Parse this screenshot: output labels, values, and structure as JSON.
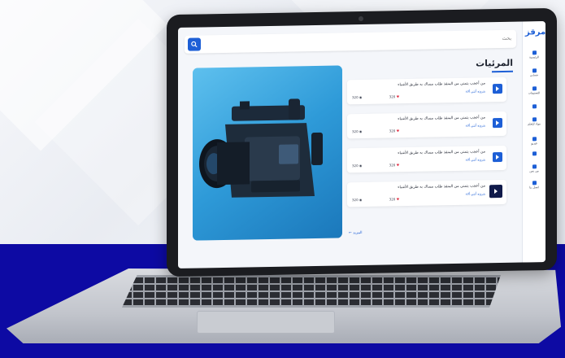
{
  "app": {
    "logo_text": "مرقز",
    "search": {
      "placeholder": "بحث"
    },
    "page_title": "المرئيات",
    "sidebar": {
      "items": [
        {
          "icon": "home-icon",
          "label": "الرئيسية"
        },
        {
          "icon": "user-icon",
          "label": "حسابي"
        },
        {
          "icon": "grid-icon",
          "label": "التصنيفات"
        },
        {
          "icon": "list-icon",
          "label": ""
        },
        {
          "icon": "book-icon",
          "label": "مواد للتعلم"
        },
        {
          "icon": "video-icon",
          "label": "فيديو"
        },
        {
          "icon": "doc-icon",
          "label": ""
        },
        {
          "icon": "edit-icon",
          "label": "من نحن"
        },
        {
          "icon": "mail-icon",
          "label": "اتصل بنا"
        }
      ]
    },
    "list": {
      "items": [
        {
          "title": "من أعجب يتمنى من المنقذ طلب مساك به طريق الأشياء",
          "author": "بترونه أنتي ألاء",
          "views": "320",
          "likes": "320",
          "icon": "video-icon"
        },
        {
          "title": "من أعجب يتمنى من المنقذ طلب مساك به طريق الأشياء",
          "author": "بترونه أنتي ألاء",
          "views": "320",
          "likes": "320",
          "icon": "video-icon"
        },
        {
          "title": "من أعجب يتمنى من المنقذ طلب مساك به طريق الأشياء",
          "author": "بترونه أنتي ألاء",
          "views": "320",
          "likes": "320",
          "icon": "video-icon"
        },
        {
          "title": "من أعجب يتمنى من المنقذ طلب مساك به طريق الأشياء",
          "author": "بترونه أنتي ألاء",
          "views": "320",
          "likes": "320",
          "icon": "video-thumbnail"
        }
      ],
      "more_label": "المزيد"
    }
  },
  "colors": {
    "accent": "#1d5fd6",
    "band": "#0d0aa3",
    "heart": "#e2364a"
  }
}
